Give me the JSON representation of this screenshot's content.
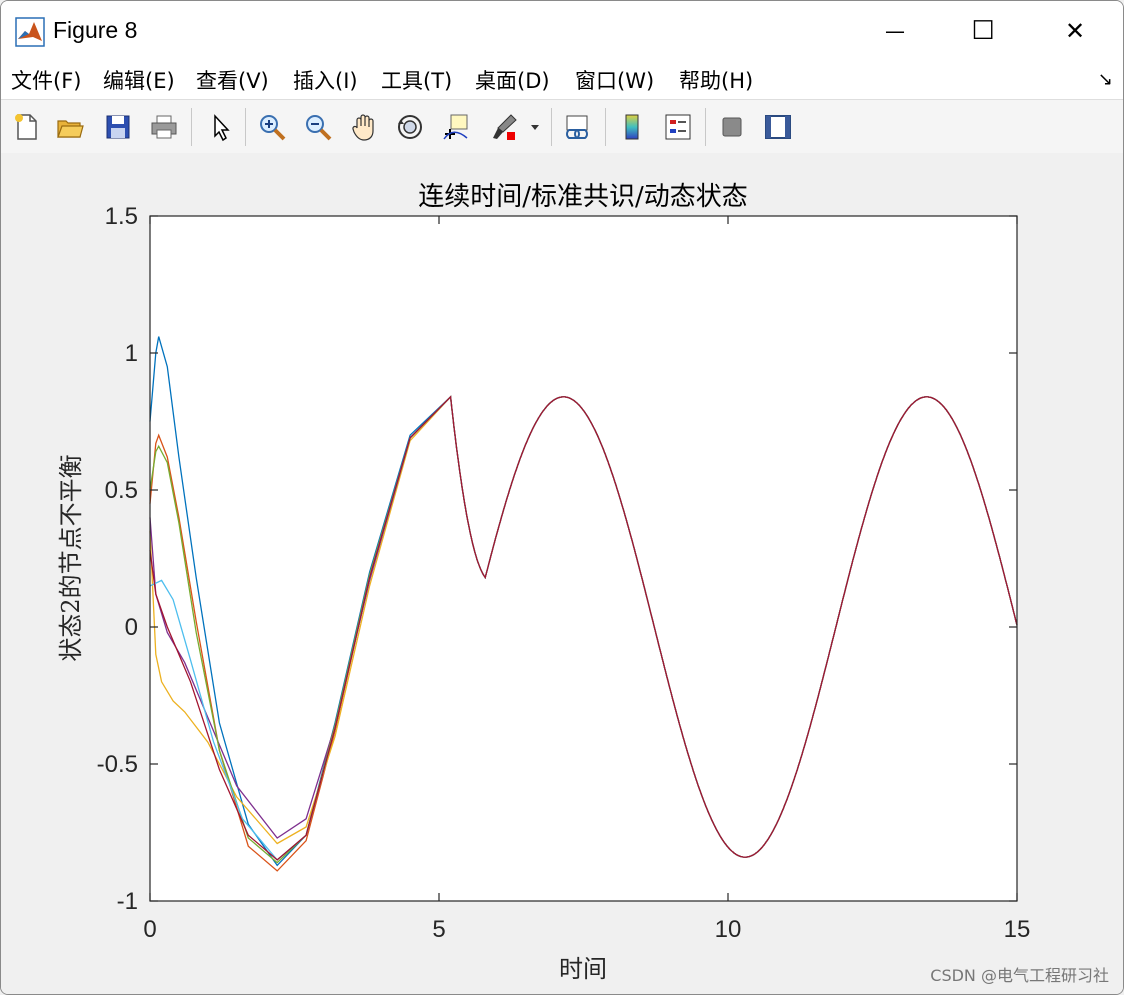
{
  "window": {
    "title": "Figure 8",
    "minimize_glyph": "—",
    "maximize_glyph": "☐",
    "close_glyph": "✕"
  },
  "menu": {
    "items": [
      {
        "label": "文件(F)"
      },
      {
        "label": "编辑(E)"
      },
      {
        "label": "查看(V)"
      },
      {
        "label": "插入(I)"
      },
      {
        "label": "工具(T)"
      },
      {
        "label": "桌面(D)"
      },
      {
        "label": "窗口(W)"
      },
      {
        "label": "帮助(H)"
      }
    ],
    "dock_arrow": "↘"
  },
  "toolbar": {
    "icons": [
      "new-file-icon",
      "open-folder-icon",
      "save-icon",
      "print-icon",
      "pointer-icon",
      "zoom-in-icon",
      "zoom-out-icon",
      "pan-hand-icon",
      "rotate-3d-icon",
      "data-cursor-icon",
      "brush-icon",
      "link-plot-icon",
      "colorbar-icon",
      "legend-icon",
      "hide-plot-tools-icon",
      "show-plot-tools-icon"
    ]
  },
  "watermark": "CSDN @电气工程研习社",
  "chart_data": {
    "type": "line",
    "title": "连续时间/标准共识/动态状态",
    "xlabel": "时间",
    "ylabel": "状态2的节点不平衡",
    "xlim": [
      0,
      15
    ],
    "ylim": [
      -1,
      1.5
    ],
    "xticks": [
      "0",
      "5",
      "10",
      "15"
    ],
    "yticks": [
      "-1",
      "-0.5",
      "0",
      "0.5",
      "1",
      "1.5"
    ],
    "grid": false,
    "common_tail": {
      "amplitude": 0.84,
      "omega": 1.0,
      "phase": 0.7
    },
    "series": [
      {
        "color": "#0072BD",
        "points": [
          [
            0,
            0.75
          ],
          [
            0.1,
            1.0
          ],
          [
            0.15,
            1.06
          ],
          [
            0.3,
            0.95
          ],
          [
            0.5,
            0.62
          ],
          [
            0.8,
            0.18
          ],
          [
            1.2,
            -0.35
          ],
          [
            1.7,
            -0.72
          ],
          [
            2.2,
            -0.87
          ],
          [
            2.7,
            -0.76
          ],
          [
            3.2,
            -0.35
          ],
          [
            3.8,
            0.2
          ],
          [
            4.5,
            0.7
          ],
          [
            5.2,
            0.84
          ]
        ]
      },
      {
        "color": "#D95319",
        "points": [
          [
            0,
            0.45
          ],
          [
            0.1,
            0.67
          ],
          [
            0.15,
            0.7
          ],
          [
            0.3,
            0.62
          ],
          [
            0.5,
            0.4
          ],
          [
            0.8,
            0.02
          ],
          [
            1.2,
            -0.45
          ],
          [
            1.7,
            -0.8
          ],
          [
            2.2,
            -0.89
          ],
          [
            2.7,
            -0.78
          ],
          [
            3.2,
            -0.38
          ],
          [
            3.8,
            0.18
          ],
          [
            4.5,
            0.69
          ],
          [
            5.2,
            0.84
          ]
        ]
      },
      {
        "color": "#EDB120",
        "points": [
          [
            0,
            0.35
          ],
          [
            0.1,
            -0.1
          ],
          [
            0.2,
            -0.2
          ],
          [
            0.4,
            -0.27
          ],
          [
            0.6,
            -0.31
          ],
          [
            1.0,
            -0.42
          ],
          [
            1.5,
            -0.62
          ],
          [
            2.2,
            -0.79
          ],
          [
            2.7,
            -0.73
          ],
          [
            3.2,
            -0.4
          ],
          [
            3.8,
            0.15
          ],
          [
            4.5,
            0.68
          ],
          [
            5.2,
            0.84
          ]
        ]
      },
      {
        "color": "#7E2F8E",
        "points": [
          [
            0,
            0.4
          ],
          [
            0.1,
            0.12
          ],
          [
            0.3,
            -0.02
          ],
          [
            0.6,
            -0.13
          ],
          [
            1.0,
            -0.33
          ],
          [
            1.5,
            -0.58
          ],
          [
            2.2,
            -0.77
          ],
          [
            2.7,
            -0.7
          ],
          [
            3.2,
            -0.36
          ],
          [
            3.8,
            0.17
          ],
          [
            4.5,
            0.69
          ],
          [
            5.2,
            0.84
          ]
        ]
      },
      {
        "color": "#77AC30",
        "points": [
          [
            0,
            0.5
          ],
          [
            0.1,
            0.64
          ],
          [
            0.15,
            0.66
          ],
          [
            0.3,
            0.6
          ],
          [
            0.5,
            0.38
          ],
          [
            0.8,
            -0.02
          ],
          [
            1.2,
            -0.45
          ],
          [
            1.7,
            -0.77
          ],
          [
            2.2,
            -0.86
          ],
          [
            2.7,
            -0.76
          ],
          [
            3.2,
            -0.36
          ],
          [
            3.8,
            0.19
          ],
          [
            4.5,
            0.69
          ],
          [
            5.2,
            0.84
          ]
        ]
      },
      {
        "color": "#4DBEEE",
        "points": [
          [
            0,
            0.15
          ],
          [
            0.2,
            0.17
          ],
          [
            0.4,
            0.1
          ],
          [
            0.7,
            -0.12
          ],
          [
            1.1,
            -0.42
          ],
          [
            1.6,
            -0.7
          ],
          [
            2.2,
            -0.85
          ],
          [
            2.7,
            -0.76
          ],
          [
            3.2,
            -0.37
          ],
          [
            3.8,
            0.18
          ],
          [
            4.5,
            0.69
          ],
          [
            5.2,
            0.84
          ]
        ]
      },
      {
        "color": "#A2142F",
        "points": [
          [
            0,
            0.28
          ],
          [
            0.1,
            0.12
          ],
          [
            0.3,
            0.0
          ],
          [
            0.7,
            -0.2
          ],
          [
            1.2,
            -0.52
          ],
          [
            1.7,
            -0.76
          ],
          [
            2.2,
            -0.85
          ],
          [
            2.7,
            -0.76
          ],
          [
            3.2,
            -0.37
          ],
          [
            3.8,
            0.18
          ],
          [
            4.5,
            0.69
          ],
          [
            5.2,
            0.84
          ]
        ]
      }
    ]
  }
}
